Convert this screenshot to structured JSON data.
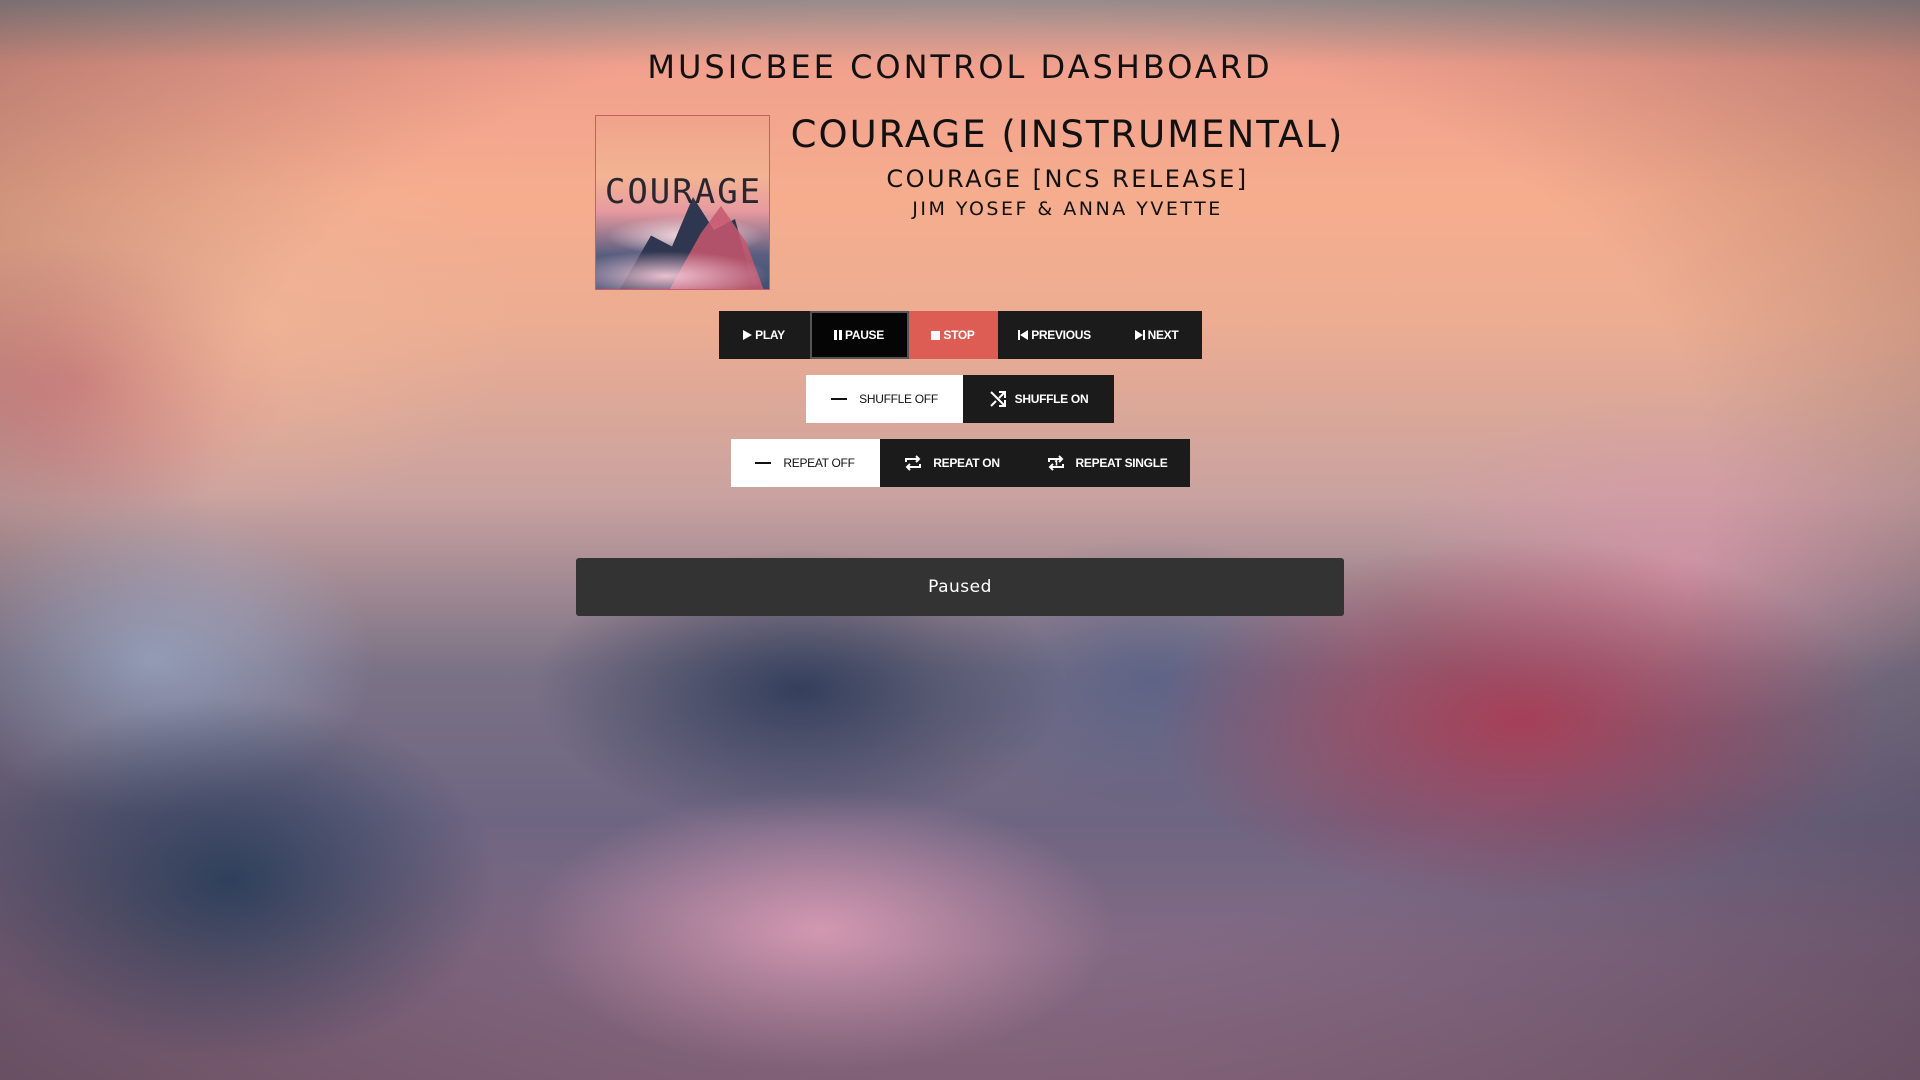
{
  "page": {
    "title": "MUSICBEE CONTROL DASHBOARD"
  },
  "now_playing": {
    "title": "COURAGE (INSTRUMENTAL)",
    "album": "COURAGE [NCS RELEASE]",
    "artist": "JIM YOSEF & ANNA YVETTE",
    "album_art": {
      "cover_text": "COURAGE",
      "palette": [
        "#f3b493",
        "#e79aa0",
        "#2e3650",
        "#c8576e"
      ]
    }
  },
  "transport": {
    "buttons": [
      {
        "label": "PLAY",
        "icon": "play-icon",
        "active": false
      },
      {
        "label": "PAUSE",
        "icon": "pause-icon",
        "active": true
      },
      {
        "label": "STOP",
        "icon": "stop-icon",
        "active": false
      },
      {
        "label": "PREVIOUS",
        "icon": "previous-icon",
        "active": false
      },
      {
        "label": "NEXT",
        "icon": "next-icon",
        "active": false
      }
    ]
  },
  "shuffle": {
    "buttons": [
      {
        "label": "SHUFFLE OFF",
        "icon": "dash-icon",
        "selected": true
      },
      {
        "label": "SHUFFLE ON",
        "icon": "shuffle-icon",
        "selected": false
      }
    ]
  },
  "repeat": {
    "buttons": [
      {
        "label": "REPEAT OFF",
        "icon": "dash-icon",
        "selected": true
      },
      {
        "label": "REPEAT ON",
        "icon": "repeat-icon",
        "selected": false
      },
      {
        "label": "REPEAT SINGLE",
        "icon": "repeat-one-icon",
        "selected": false
      }
    ]
  },
  "status": {
    "text": "Paused"
  },
  "colors": {
    "button_dark": "#1b1b1b",
    "button_active": "#050505",
    "button_light": "#ffffff",
    "stop_accent": "#dd5c54",
    "status_bar": "#333333"
  }
}
